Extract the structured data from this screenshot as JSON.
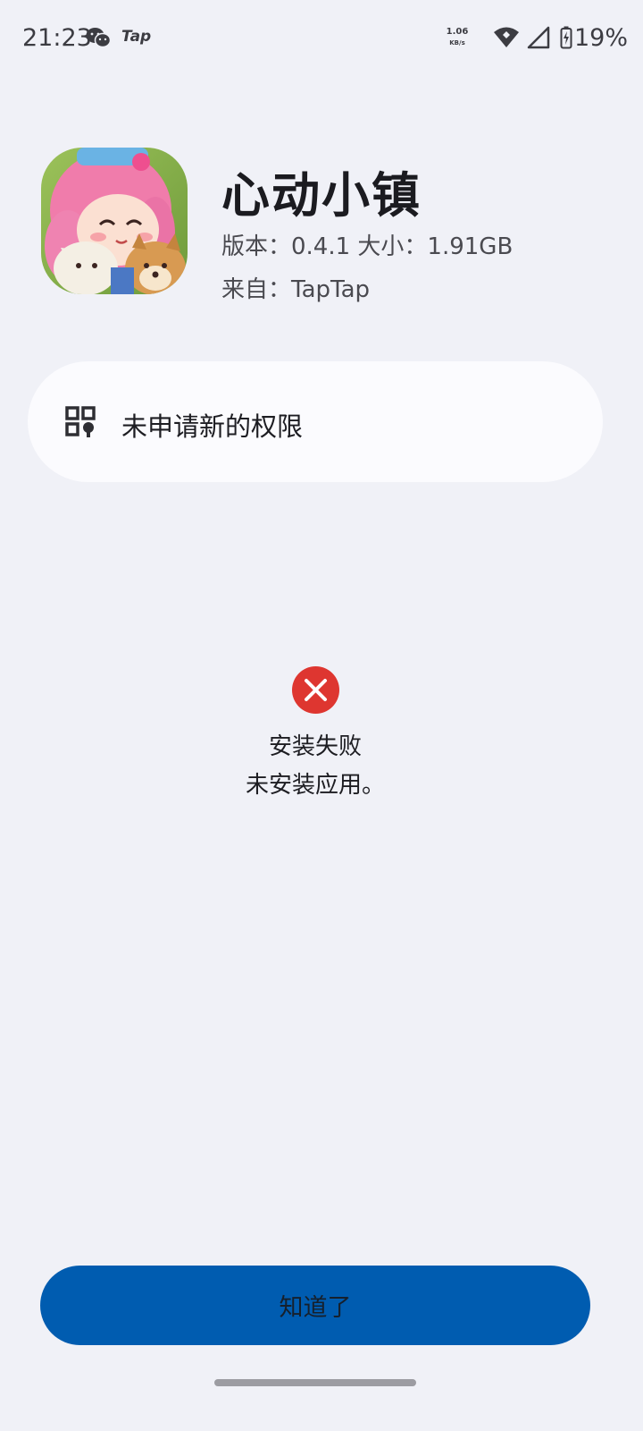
{
  "status_bar": {
    "time": "21:23",
    "notification_icons": [
      "wechat-icon",
      "tap-icon"
    ],
    "tap_label": "Tap",
    "net_speed_value": "1.06",
    "net_speed_unit": "KB/s",
    "battery_percent": "19%"
  },
  "app": {
    "name": "心动小镇",
    "version_line": "版本：0.4.1 大小：1.91GB",
    "source_line": "来自：TapTap",
    "icon": "app-icon"
  },
  "permissions": {
    "label": "未申请新的权限",
    "icon": "permission-grid-icon"
  },
  "result": {
    "icon": "error-x-icon",
    "title": "安装失败",
    "message": "未安装应用。"
  },
  "button": {
    "label": "知道了"
  },
  "colors": {
    "background": "#f0f1f7",
    "card": "#fbfbfe",
    "error": "#de3630",
    "primary_button": "#005cb0"
  }
}
